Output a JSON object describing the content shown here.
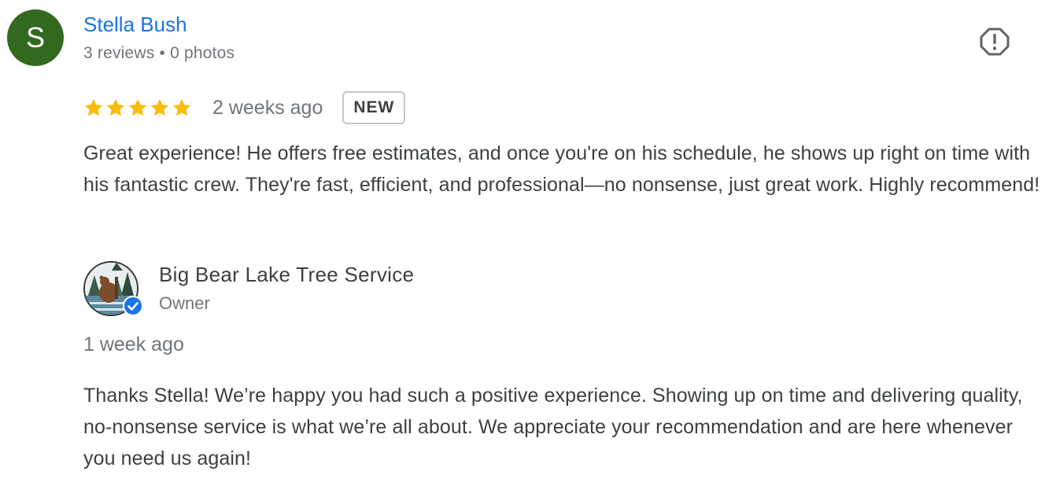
{
  "reviewer": {
    "initial": "S",
    "name": "Stella Bush",
    "reviews_count": "3 reviews",
    "separator": "•",
    "photos_count": "0 photos",
    "avatar_color": "#33691e"
  },
  "review": {
    "rating": 5,
    "max_rating": 5,
    "star_color": "#fbbc04",
    "date": "2 weeks ago",
    "badge": "NEW",
    "text": "Great experience! He offers free estimates, and once you're on his schedule, he shows up right on time with his fantastic crew. They're fast, efficient, and professional—no nonsense, just great work. Highly recommend!"
  },
  "actions": {
    "flag_icon": "report-flag-icon"
  },
  "owner": {
    "name": "Big Bear Lake Tree Service",
    "role": "Owner",
    "logo_icon": "bear-tree-logo",
    "verified_icon": "verified-badge-icon",
    "verified_color": "#1a73e8"
  },
  "reply": {
    "date": "1 week ago",
    "text": "Thanks Stella! We’re happy you had such a positive experience. Showing up on time and delivering quality, no-nonsense service is what we’re all about. We appreciate your recommendation and are here whenever you need us again!"
  },
  "colors": {
    "link": "#1a73e8",
    "secondary_text": "#70757a",
    "primary_text": "#3c4043"
  }
}
